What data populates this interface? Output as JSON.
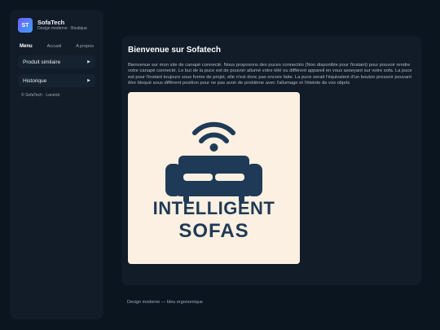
{
  "brand": {
    "logo_text": "ST",
    "name": "SofaTech",
    "subtitle": "Design moderne · Boutique"
  },
  "nav": {
    "menu": "Menu",
    "home": "Accueil",
    "about": "A propos"
  },
  "sidebar": {
    "items": [
      {
        "label": "Produit similaire",
        "icon": "chevron-right-icon"
      },
      {
        "label": "Historique",
        "icon": "chevron-right-icon"
      }
    ],
    "footer": "© SofaTech · Laneick"
  },
  "main": {
    "title": "Bienvenue sur Sofatech",
    "description": "Bienvenue sur mon site de canapé connecté. Nous proposons des puces connectés (Non disponible pour l'instant) pour pouvoir rendre votre canapé connecté. Le but de la puce est de pouvoir allumé votre télé ou différent appareil en vous asseyant sur votre sofa. La puce est pour l'instant toujours sous forme de projet, elle n'est donc pas encore faite. La puce serait l'équivalent d'un bouton pressoir pouvant être bloqué sous différent position pour ne pas avoir de problème avec l'allumage et l'éteinte de vos objets",
    "hero": {
      "line1": "INTELLIGENT",
      "line2": "SOFAS",
      "icon": "wifi-sofa-icon",
      "colors": {
        "background": "#fbf0e1",
        "ink": "#1f3a56"
      }
    }
  },
  "footer": {
    "note": "Design moderne — bleu ergonomique"
  }
}
